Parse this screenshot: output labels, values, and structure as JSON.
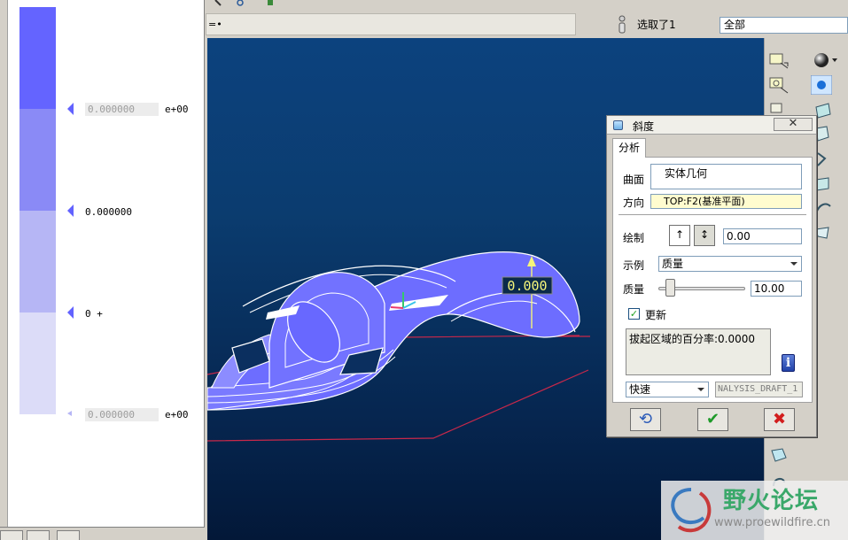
{
  "scale": {
    "colors": [
      "#6464ff",
      "#8a8af6",
      "#b6b6f5",
      "#dcdcf8"
    ],
    "marker_top_value": "0.000000",
    "marker_top_exp": "e+00",
    "marker_mid_value": "0.000000",
    "marker_zero": "0 +",
    "marker_bottom_value": "0.000000",
    "marker_bottom_exp": "e+00"
  },
  "topbar": {
    "message": "=•",
    "selected_label": "选取了1",
    "filter_value": "全部"
  },
  "viewport": {
    "dimension_label": "0.000"
  },
  "dialog": {
    "title": "斜度",
    "close_symbol": "✕",
    "tab_label": "分析",
    "surface_label": "曲面",
    "surface_value": "实体几何",
    "direction_label": "方向",
    "direction_value": "TOP:F2(基准平面)",
    "draw_label": "绘制",
    "draw_up_symbol": "↑",
    "draw_updown_symbol": "↕",
    "draw_value": "0.00",
    "sample_label": "示例",
    "sample_value": "质量",
    "quality_label": "质量",
    "quality_value": "10.00",
    "update_label": "更新",
    "update_check_symbol": "✓",
    "result_text": "拔起区域的百分率:0.0000",
    "info_symbol": "i",
    "speed_value": "快速",
    "name_value": "NALYSIS_DRAFT_1",
    "btn_repeat_symbol": "⟲",
    "btn_ok_symbol": "✔",
    "btn_cancel_symbol": "✖"
  },
  "watermark": {
    "title": "野火论坛",
    "url": "www.proewildfire.cn"
  },
  "colors": {
    "model_fill": "#6d6dff",
    "model_edge": "#ffffff",
    "datum_plane": "#c8284a",
    "dimension_text": "#f5f57a"
  }
}
